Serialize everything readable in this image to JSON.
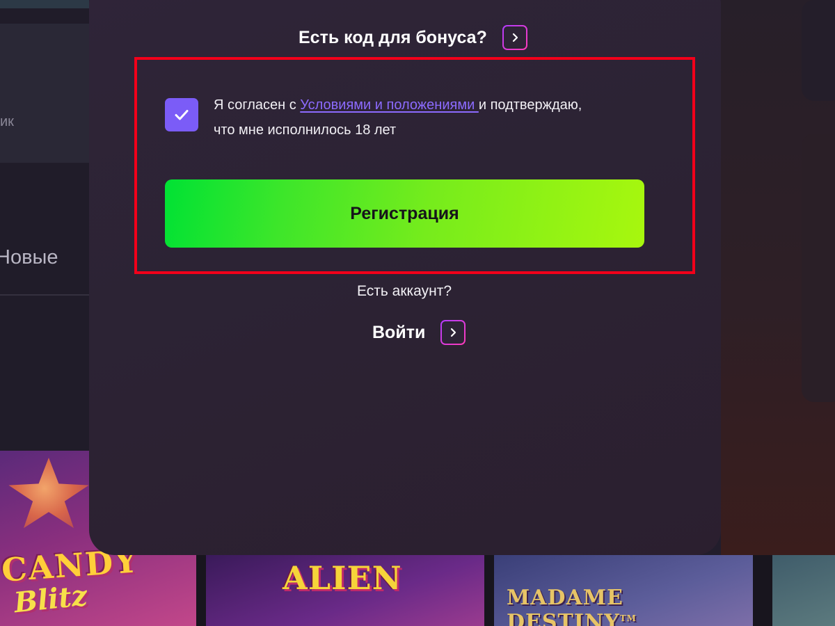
{
  "background": {
    "card_partial_text": "ик",
    "section_partial_text": "Новые"
  },
  "modal": {
    "bonus": {
      "question": "Есть код для бонуса?",
      "toggle_icon": "chevron-right-icon"
    },
    "terms": {
      "checked": true,
      "text_before": "Я согласен с ",
      "link_text": "Условиями и положениями ",
      "text_after": "и подтверждаю, что мне исполнилось 18 лет"
    },
    "register_button": "Регистрация",
    "have_account": "Есть аккаунт?",
    "login": {
      "label": "Войти",
      "icon": "chevron-right-icon"
    }
  },
  "games": [
    {
      "title_line1": "CANDY",
      "title_line2": "Blitz"
    },
    {
      "title_line1": "ALIEN"
    },
    {
      "title_line1": "MADAME DESTINY",
      "trademark": "TM"
    }
  ],
  "colors": {
    "accent_purple": "#7b5cf7",
    "link": "#8c6bff",
    "register_gradient_start": "#00e234",
    "register_gradient_end": "#a8f70e",
    "highlight": "#f2001a"
  }
}
